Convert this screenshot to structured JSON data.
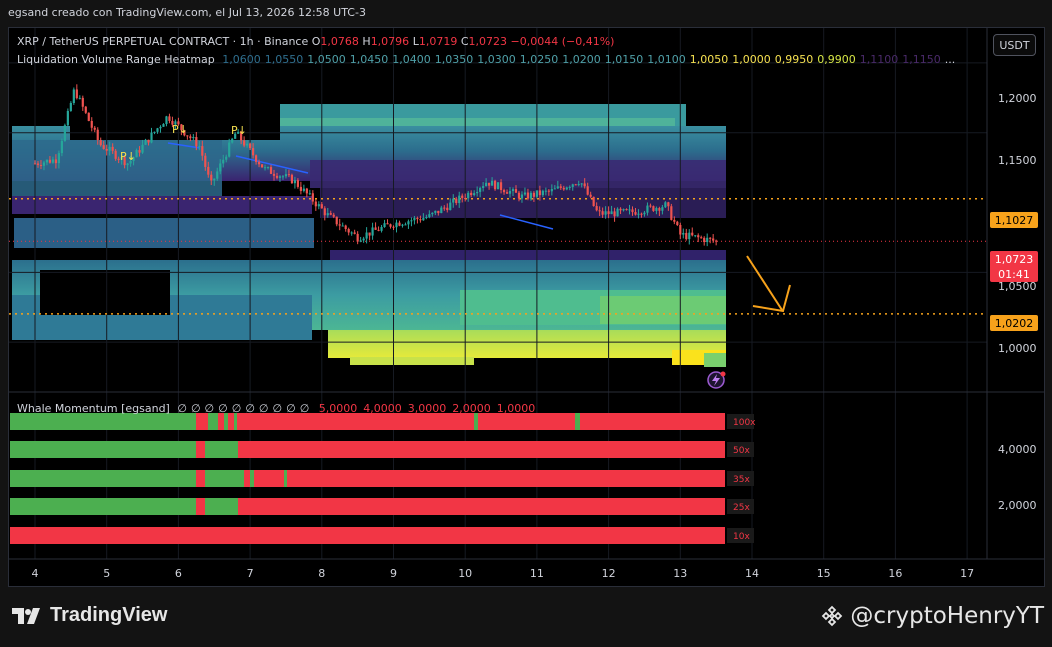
{
  "caption": "egsand creado con TradingView.com, el Jul 13, 2026 12:58 UTC-3",
  "header": {
    "symbol": "XRP / TetherUS PERPETUAL CONTRACT · 1h · Binance",
    "ohlc": {
      "open_label": "O",
      "open": "1,0768",
      "high_label": "H",
      "high": "1,0796",
      "low_label": "L",
      "low": "1,0719",
      "close_label": "C",
      "close": "1,0723",
      "change": "−0,0044 (−0,41%)"
    },
    "indicator_name": "Liquidation Volume Range Heatmap",
    "indicator_values": [
      {
        "text": "1,0600",
        "color": "#2f6f8f"
      },
      {
        "text": "1,0550",
        "color": "#2f6f8f"
      },
      {
        "text": "1,0500",
        "color": "#4fa0a8"
      },
      {
        "text": "1,0450",
        "color": "#4fa0a8"
      },
      {
        "text": "1,0400",
        "color": "#4fa0a8"
      },
      {
        "text": "1,0350",
        "color": "#4fa0a8"
      },
      {
        "text": "1,0300",
        "color": "#4fa0a8"
      },
      {
        "text": "1,0250",
        "color": "#4fa0a8"
      },
      {
        "text": "1,0200",
        "color": "#4fa0a8"
      },
      {
        "text": "1,0150",
        "color": "#4fa0a8"
      },
      {
        "text": "1,0100",
        "color": "#4fa0a8"
      },
      {
        "text": "1,0050",
        "color": "#f5e050"
      },
      {
        "text": "1,0000",
        "color": "#f5e050"
      },
      {
        "text": "0,9950",
        "color": "#f5e050"
      },
      {
        "text": "0,9900",
        "color": "#d6e645"
      },
      {
        "text": "1,1100",
        "color": "#4a2a6a"
      },
      {
        "text": "1,1150",
        "color": "#4a2a6a"
      },
      {
        "text": "...",
        "color": "#d1d4dc"
      }
    ]
  },
  "currency_button": "USDT",
  "price_axis": {
    "ticks": [
      "1,2000",
      "1,1500",
      "1,0500",
      "1,0000"
    ],
    "tag_upper": "1,1027",
    "tag_current": "1,0723",
    "tag_countdown": "01:41",
    "tag_lower": "1,0202"
  },
  "pivot_labels": [
    "P↓",
    "P↓",
    "P↓"
  ],
  "whale": {
    "title": "Whale Momentum [egsand]",
    "zeros": [
      "∅",
      "∅",
      "∅",
      "∅",
      "∅",
      "∅",
      "∅",
      "∅",
      "∅",
      "∅"
    ],
    "values": [
      "5,0000",
      "4,0000",
      "3,0000",
      "2,0000",
      "1,0000"
    ],
    "rows": [
      "100x",
      "50x",
      "35x",
      "25x",
      "10x"
    ],
    "axis_ticks": [
      "4,0000",
      "2,0000"
    ]
  },
  "x_axis": [
    "4",
    "5",
    "6",
    "7",
    "8",
    "9",
    "10",
    "11",
    "12",
    "13",
    "14",
    "15",
    "16",
    "17"
  ],
  "footer": {
    "brand": "TradingView",
    "watermark": "@cryptoHenryYT"
  },
  "colors": {
    "up": "#26a69a",
    "down": "#ef5350",
    "orange": "#f7a21b",
    "current": "#f23645",
    "whale_green": "#4caf50",
    "whale_red": "#f23645",
    "trendline": "#2962ff"
  },
  "chart_data": [
    {
      "type": "candlestick",
      "x_axis_labels": [
        "4",
        "5",
        "6",
        "7",
        "8",
        "9",
        "10",
        "11",
        "12",
        "13",
        "14",
        "15",
        "16",
        "17"
      ],
      "y_axis_ticks": [
        1.0,
        1.05,
        1.15,
        1.2
      ],
      "ylim": [
        0.965,
        1.225
      ],
      "close_path_approx": [
        {
          "day": 4.0,
          "close": 1.128
        },
        {
          "day": 4.3,
          "close": 1.131
        },
        {
          "day": 4.55,
          "close": 1.181
        },
        {
          "day": 4.9,
          "close": 1.142
        },
        {
          "day": 5.3,
          "close": 1.128
        },
        {
          "day": 5.85,
          "close": 1.162
        },
        {
          "day": 6.3,
          "close": 1.14
        },
        {
          "day": 6.45,
          "close": 1.112
        },
        {
          "day": 6.8,
          "close": 1.15
        },
        {
          "day": 7.2,
          "close": 1.124
        },
        {
          "day": 7.6,
          "close": 1.116
        },
        {
          "day": 8.1,
          "close": 1.09
        },
        {
          "day": 8.5,
          "close": 1.075
        },
        {
          "day": 9.0,
          "close": 1.085
        },
        {
          "day": 9.5,
          "close": 1.09
        },
        {
          "day": 10.0,
          "close": 1.105
        },
        {
          "day": 10.3,
          "close": 1.115
        },
        {
          "day": 10.8,
          "close": 1.104
        },
        {
          "day": 11.2,
          "close": 1.108
        },
        {
          "day": 11.6,
          "close": 1.116
        },
        {
          "day": 11.85,
          "close": 1.092
        },
        {
          "day": 12.3,
          "close": 1.093
        },
        {
          "day": 12.8,
          "close": 1.098
        },
        {
          "day": 13.0,
          "close": 1.077
        },
        {
          "day": 13.5,
          "close": 1.0723
        }
      ],
      "horizontal_levels": [
        1.1027,
        1.0723,
        1.0202
      ],
      "last": {
        "open": 1.0768,
        "high": 1.0796,
        "low": 1.0719,
        "close": 1.0723
      }
    },
    {
      "type": "heatmap",
      "series_name": "Liquidation Volume Range Heatmap"
    },
    {
      "type": "heatmap",
      "series_name": "Whale Momentum [egsand]",
      "rows": [
        "100x",
        "50x",
        "35x",
        "25x",
        "10x"
      ],
      "y_axis_ticks": [
        4.0,
        2.0
      ]
    }
  ]
}
